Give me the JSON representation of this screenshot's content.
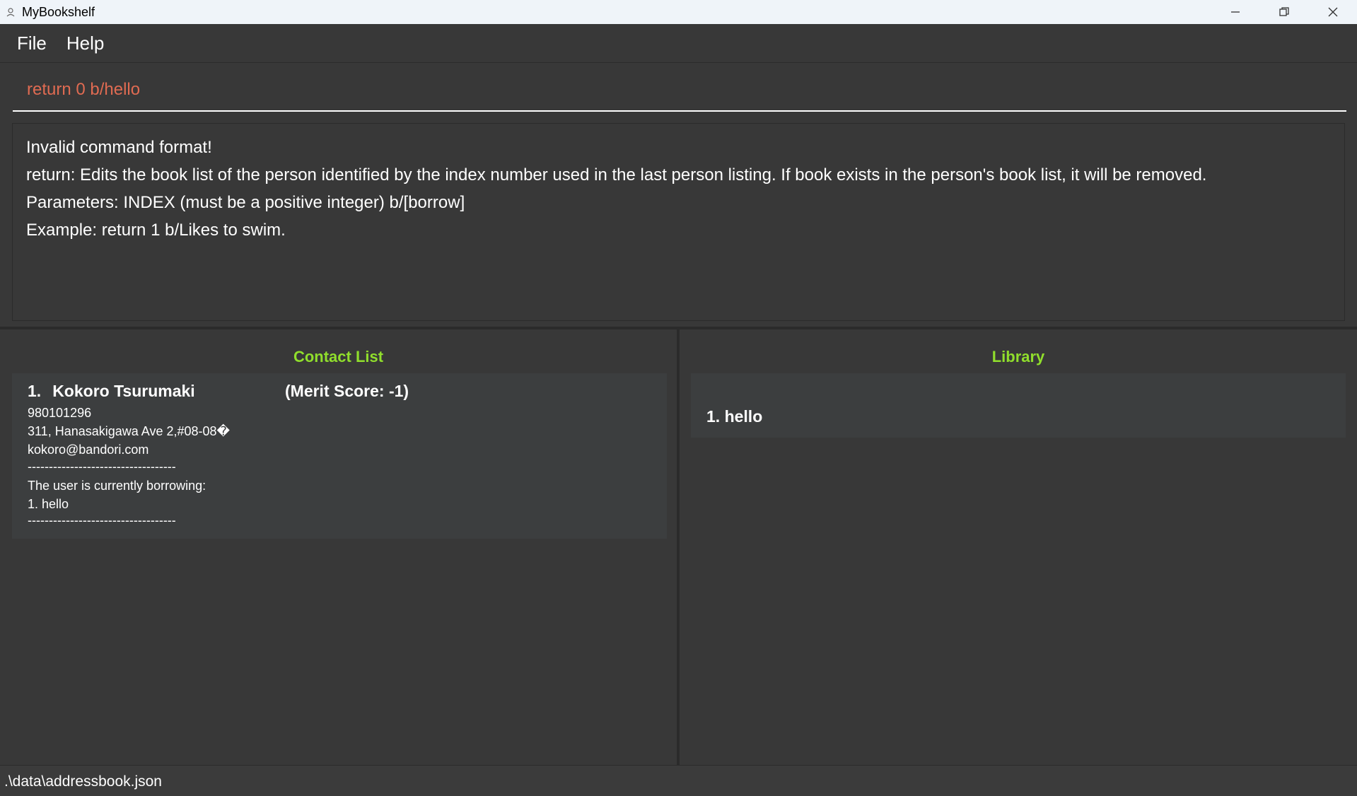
{
  "window": {
    "title": "MyBookshelf"
  },
  "menu": {
    "file": "File",
    "help": "Help"
  },
  "command": {
    "value": "return 0 b/hello"
  },
  "result": {
    "lines": [
      "Invalid command format!",
      "return: Edits the book list of the person identified by the index number used in the last person listing. If book exists in the person's book list, it will be removed.",
      "Parameters: INDEX (must be a positive integer) b/[borrow]",
      "Example: return 1 b/Likes to swim."
    ]
  },
  "contact_list": {
    "title": "Contact List",
    "persons": [
      {
        "index": "1.",
        "name": "Kokoro Tsurumaki",
        "merit": "(Merit Score: -1)",
        "phone": "980101296",
        "address": "311, Hanasakigawa Ave 2,#08-08�",
        "email": "kokoro@bandori.com",
        "separator": "-----------------------------------",
        "borrowing_label": "The user is currently borrowing:",
        "borrowing_items": [
          "1. hello"
        ],
        "separator_end": "-----------------------------------"
      }
    ]
  },
  "library": {
    "title": "Library",
    "items": [
      "1. hello"
    ]
  },
  "status": {
    "path": ".\\data\\addressbook.json"
  },
  "colors": {
    "accent_green": "#90de2c",
    "command_error": "#e06b52",
    "background": "#383838",
    "card": "#3c3e3f"
  },
  "icons": {
    "app": "person-icon",
    "minimize": "minimize-icon",
    "restore": "restore-icon",
    "close": "close-icon"
  }
}
